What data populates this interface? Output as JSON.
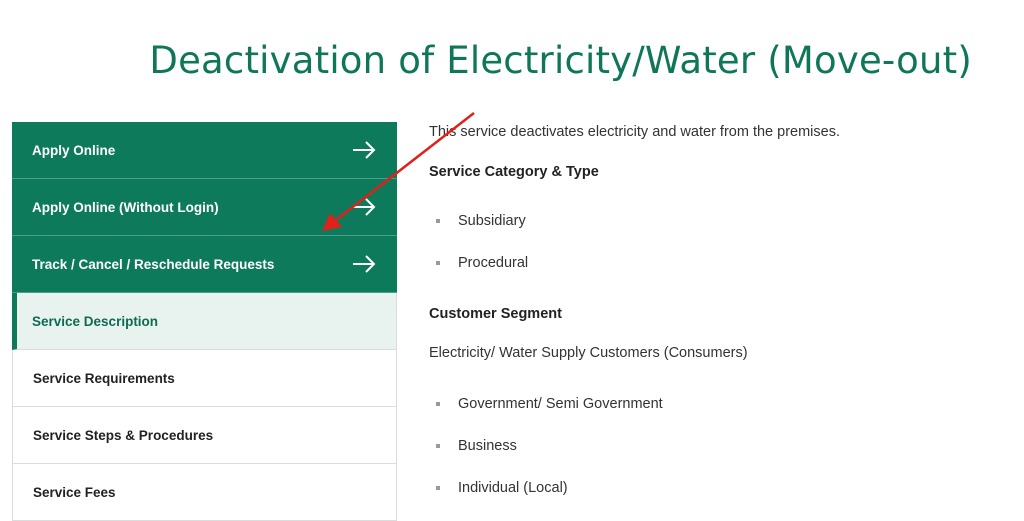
{
  "page": {
    "title": "Deactivation of Electricity/Water (Move-out)"
  },
  "sidebar": {
    "items": [
      {
        "label": "Apply Online"
      },
      {
        "label": "Apply Online (Without Login)"
      },
      {
        "label": "Track / Cancel / Reschedule Requests"
      },
      {
        "label": "Service Description"
      },
      {
        "label": "Service Requirements"
      },
      {
        "label": "Service Steps & Procedures"
      },
      {
        "label": "Service Fees"
      }
    ]
  },
  "content": {
    "description": "This service deactivates electricity and water from the premises.",
    "category_heading": "Service Category & Type",
    "categories": [
      "Subsidiary",
      "Procedural"
    ],
    "segment_heading": "Customer Segment",
    "segment_text": "Electricity/ Water Supply Customers (Consumers)",
    "segments": [
      "Government/ Semi Government",
      "Business",
      "Individual (Local)"
    ]
  },
  "colors": {
    "brand_green": "#0e7a5c",
    "title_green": "#0f7659",
    "annotation_red": "#e0201a"
  }
}
